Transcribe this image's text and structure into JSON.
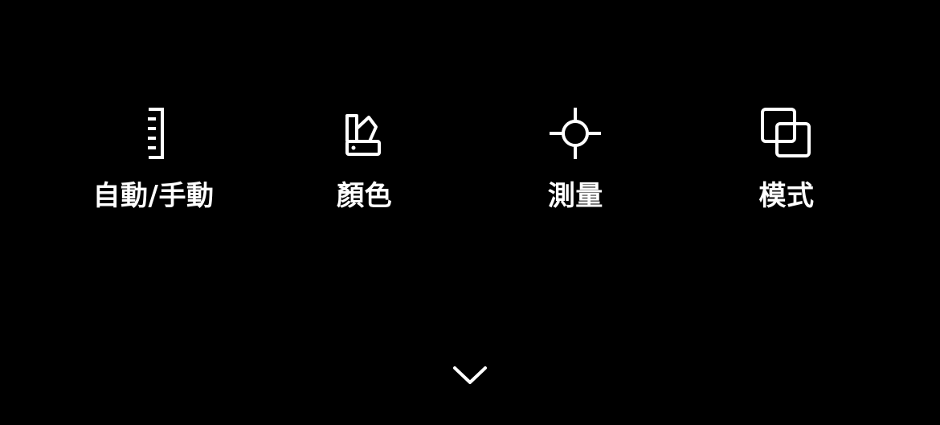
{
  "menu": {
    "items": [
      {
        "label": "自動/手動",
        "icon": "ruler-icon"
      },
      {
        "label": "顏色",
        "icon": "color-swatch-icon"
      },
      {
        "label": "測量",
        "icon": "crosshair-icon"
      },
      {
        "label": "模式",
        "icon": "overlap-squares-icon"
      }
    ]
  },
  "collapse": {
    "icon": "chevron-down-icon"
  },
  "colors": {
    "background": "#000000",
    "foreground": "#ffffff"
  }
}
